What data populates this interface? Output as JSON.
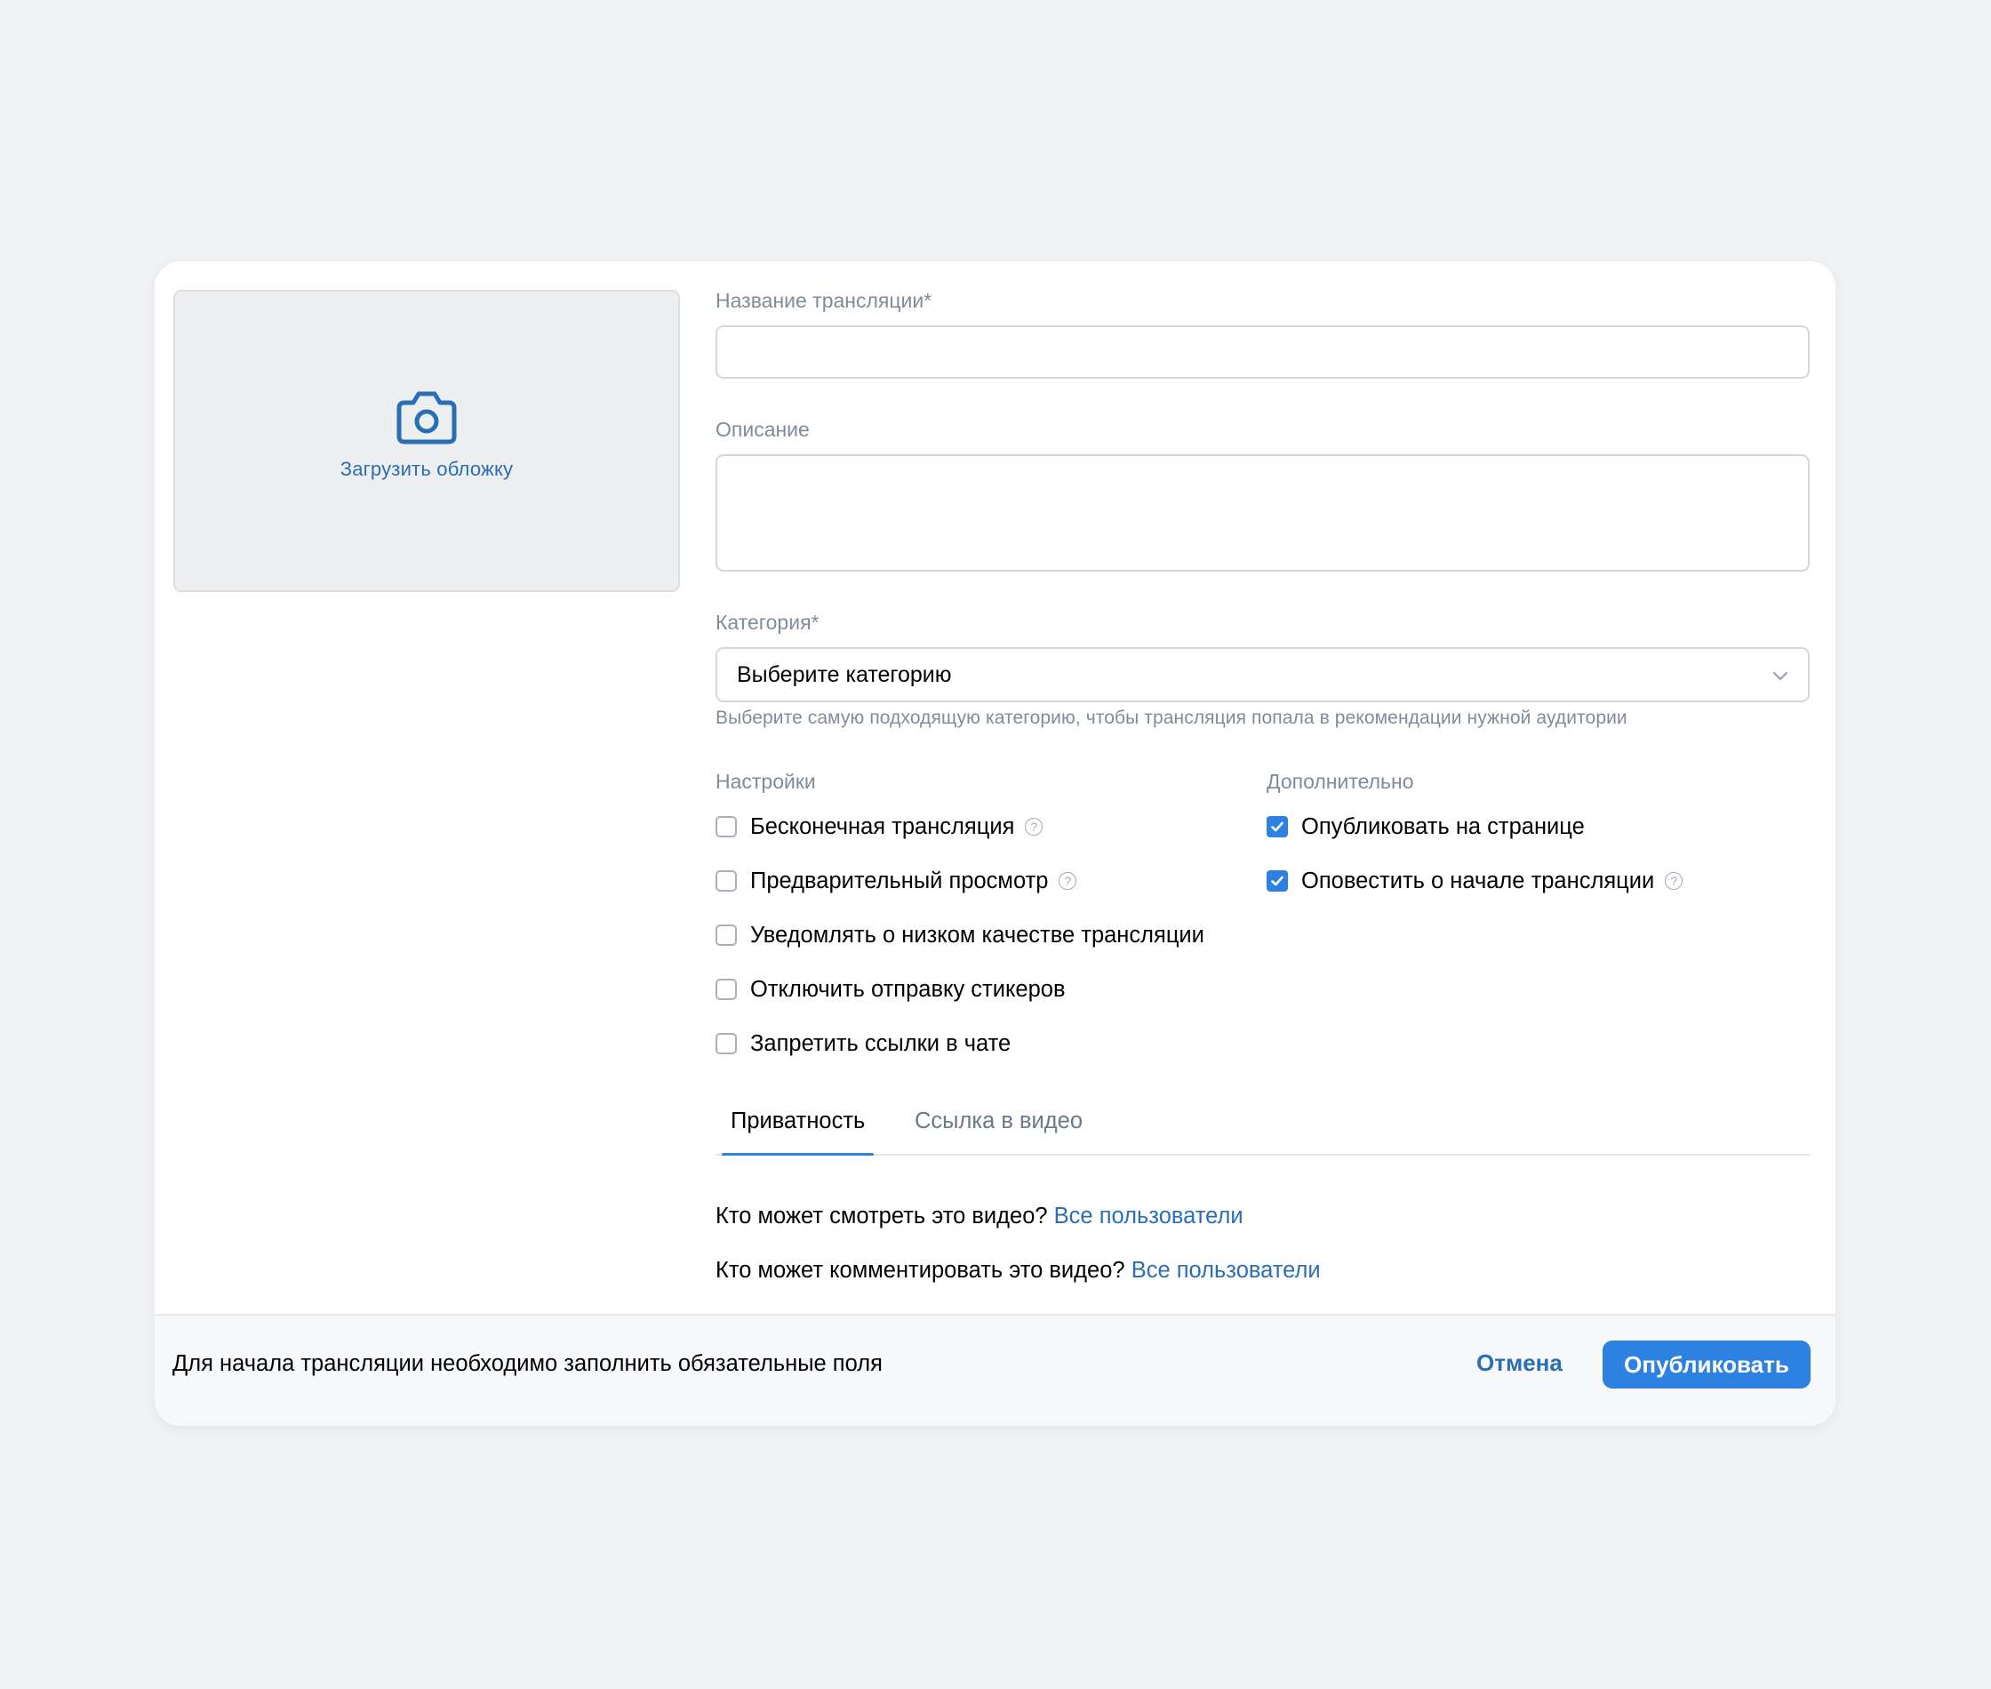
{
  "cover": {
    "label": "Загрузить обложку",
    "icon": "camera-icon"
  },
  "form": {
    "title": {
      "label": "Название трансляции*",
      "value": ""
    },
    "description": {
      "label": "Описание",
      "value": ""
    },
    "category": {
      "label": "Категория*",
      "selected": "Выберите категорию",
      "hint": "Выберите самую подходящую категорию, чтобы трансляция попала в рекомендации нужной аудитории"
    }
  },
  "settings": {
    "title": "Настройки",
    "items": [
      {
        "label": "Бесконечная трансляция",
        "checked": false,
        "help": true
      },
      {
        "label": "Предварительный просмотр",
        "checked": false,
        "help": true
      },
      {
        "label": "Уведомлять о низком качестве трансляции",
        "checked": false,
        "help": false
      },
      {
        "label": "Отключить отправку стикеров",
        "checked": false,
        "help": false
      },
      {
        "label": "Запретить ссылки в чате",
        "checked": false,
        "help": false
      }
    ]
  },
  "additional": {
    "title": "Дополнительно",
    "items": [
      {
        "label": "Опубликовать на странице",
        "checked": true,
        "help": false
      },
      {
        "label": "Оповестить о начале трансляции",
        "checked": true,
        "help": true
      }
    ]
  },
  "tabs": [
    {
      "label": "Приватность",
      "active": true
    },
    {
      "label": "Ссылка в видео",
      "active": false
    }
  ],
  "privacy": {
    "view_question": "Кто может смотреть это видео?",
    "view_value": "Все пользователи",
    "comment_question": "Кто может комментировать это видео?",
    "comment_value": "Все пользователи"
  },
  "footer": {
    "message": "Для начала трансляции необходимо заполнить обязательные поля",
    "cancel_label": "Отмена",
    "publish_label": "Опубликовать"
  },
  "colors": {
    "accent": "#2d81e0",
    "link": "#2a6fb5",
    "muted": "#818c99",
    "background": "#f1f2f4"
  }
}
